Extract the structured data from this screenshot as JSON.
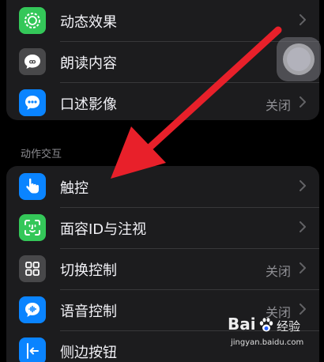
{
  "top_group": {
    "items": [
      {
        "label": "动态效果",
        "value": "",
        "icon": "motion-icon",
        "color": "#34c759"
      },
      {
        "label": "朗读内容",
        "value": "",
        "icon": "speech-bubble-icon",
        "color": "#48484a"
      },
      {
        "label": "口述影像",
        "value": "关闭",
        "icon": "audio-description-icon",
        "color": "#0a84ff"
      }
    ]
  },
  "section_header": "动作交互",
  "bottom_group": {
    "items": [
      {
        "label": "触控",
        "value": "",
        "icon": "touch-hand-icon",
        "color": "#0a84ff"
      },
      {
        "label": "面容ID与注视",
        "value": "",
        "icon": "face-id-icon",
        "color": "#34c759"
      },
      {
        "label": "切换控制",
        "value": "关闭",
        "icon": "switch-control-icon",
        "color": "#48484a"
      },
      {
        "label": "语音控制",
        "value": "关闭",
        "icon": "voice-control-icon",
        "color": "#0a84ff"
      },
      {
        "label": "侧边按钮",
        "value": "",
        "icon": "side-button-icon",
        "color": "#0a84ff"
      }
    ]
  },
  "watermark": {
    "logo_text": "Bai",
    "brand": "经验",
    "url": "jingyan.baidu.com"
  },
  "annotation_color": "#e8202a"
}
